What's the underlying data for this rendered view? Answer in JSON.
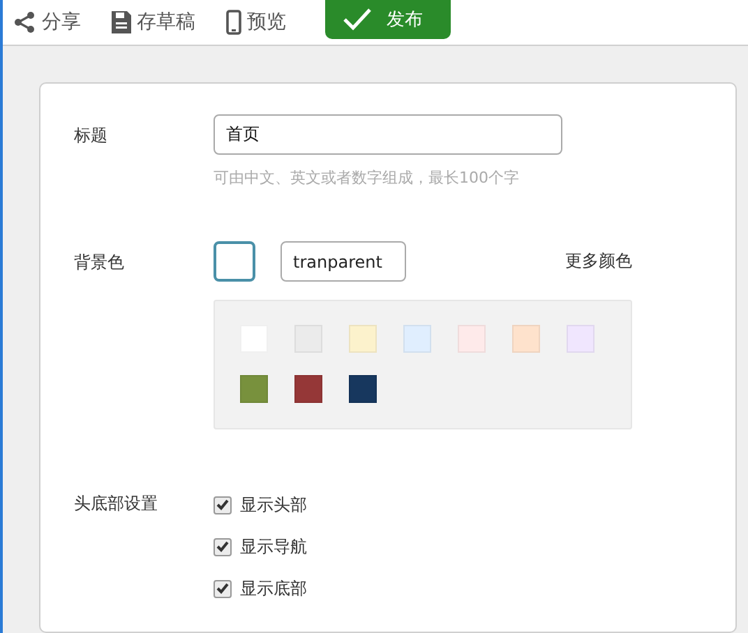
{
  "toolbar": {
    "items": [
      {
        "kind": "share",
        "label": "分享"
      },
      {
        "kind": "draft",
        "label": "存草稿"
      },
      {
        "kind": "preview",
        "label": "预览"
      },
      {
        "kind": "publish",
        "label": "发布"
      }
    ]
  },
  "form": {
    "title": {
      "label": "标题",
      "value": "首页",
      "hint": "可由中文、英文或者数字组成，最长100个字"
    },
    "background": {
      "label": "背景色",
      "value": "tranparent",
      "more": "更多颜色",
      "swatches": [
        {
          "color": "#ffffff"
        },
        {
          "color": "#ebebeb"
        },
        {
          "color": "#fcf2cc"
        },
        {
          "color": "#e0eefe"
        },
        {
          "color": "#feeaea"
        },
        {
          "color": "#fee2cc"
        },
        {
          "color": "#f0e6fe"
        },
        {
          "color": "#78913d"
        },
        {
          "color": "#953737"
        },
        {
          "color": "#17375e"
        }
      ]
    },
    "header_footer": {
      "label": "头底部设置",
      "options": [
        {
          "label": "显示头部",
          "checked": true
        },
        {
          "label": "显示导航",
          "checked": true
        },
        {
          "label": "显示底部",
          "checked": true
        }
      ]
    }
  }
}
